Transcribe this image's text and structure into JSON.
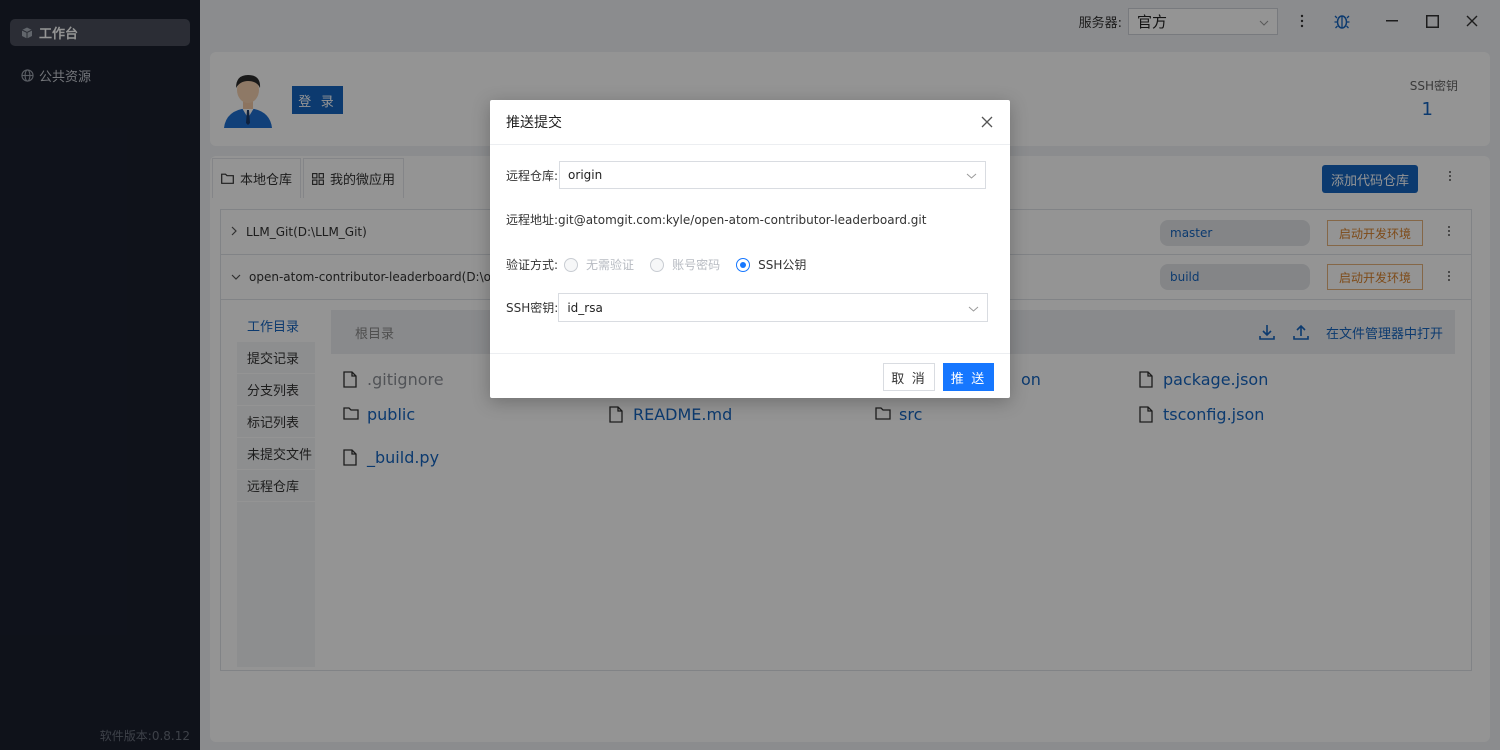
{
  "sidebar": {
    "items": [
      {
        "label": "工作台",
        "icon": "cube-icon"
      },
      {
        "label": "公共资源",
        "icon": "globe-icon"
      }
    ],
    "version": "软件版本:0.8.12"
  },
  "titlebar": {
    "server_label": "服务器:",
    "server_value": "官方"
  },
  "user": {
    "login_label": "登 录",
    "ssh_label": "SSH密钥",
    "ssh_count": "1"
  },
  "tabs": [
    {
      "label": "本地仓库"
    },
    {
      "label": "我的微应用"
    }
  ],
  "add_repo_label": "添加代码仓库",
  "repos": [
    {
      "name": "LLM_Git(D:\\LLM_Git)",
      "branch": "master",
      "env_label": "启动开发环境"
    },
    {
      "name": "open-atom-contributor-leaderboard(D:\\open-",
      "branch": "build",
      "env_label": "启动开发环境"
    }
  ],
  "subnav": [
    "工作目录",
    "提交记录",
    "分支列表",
    "标记列表",
    "未提交文件",
    "远程仓库"
  ],
  "files": {
    "header": "根目录",
    "open_in_explorer": "在文件管理器中打开",
    "items": [
      {
        "name": ".gitignore",
        "type": "file"
      },
      {
        "name": "package.json",
        "type": "file"
      },
      {
        "name": "public",
        "type": "folder"
      },
      {
        "name": "README.md",
        "type": "file"
      },
      {
        "name": "src",
        "type": "folder"
      },
      {
        "name": "tsconfig.json",
        "type": "file"
      },
      {
        "name": "_build.py",
        "type": "file"
      },
      {
        "name": "on",
        "type": "file"
      }
    ]
  },
  "dialog": {
    "title": "推送提交",
    "remote_label": "远程仓库:",
    "remote_value": "origin",
    "address_label": "远程地址:",
    "address_value": "git@atomgit.com:kyle/open-atom-contributor-leaderboard.git",
    "auth_label": "验证方式:",
    "auth_options": [
      "无需验证",
      "账号密码",
      "SSH公钥"
    ],
    "auth_selected": "SSH公钥",
    "ssh_label": "SSH密钥:",
    "ssh_value": "id_rsa",
    "cancel_label": "取 消",
    "push_label": "推 送"
  }
}
